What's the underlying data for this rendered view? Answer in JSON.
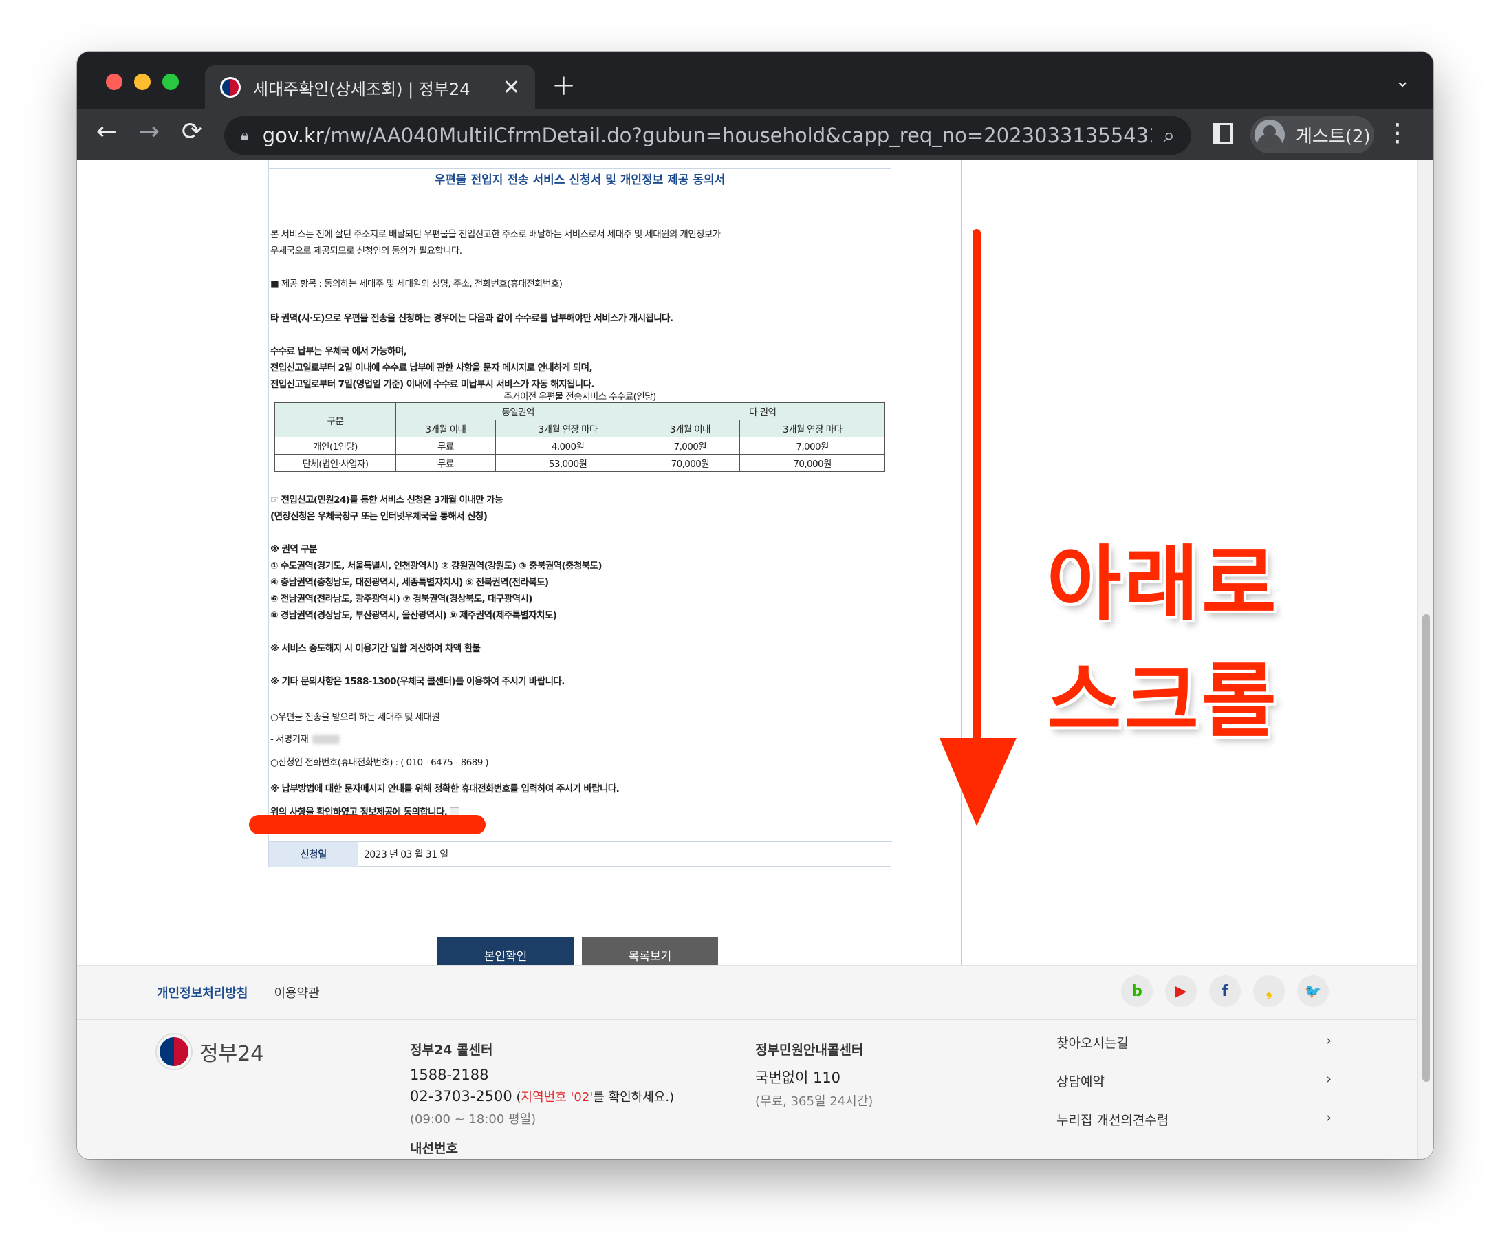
{
  "browser": {
    "tab_title": "세대주확인(상세조회) | 정부24",
    "tab_close": "✕",
    "new_tab": "+",
    "url_host": "gov.kr",
    "url_path": "/mw/AA040MultiICfrmDetail.do?gubun=household&capp_req_no=2023033135543177...",
    "profile_label": "게스트(2)"
  },
  "doc": {
    "title": "우편물 전입지 전송 서비스 신청서 및 개인정보 제공 동의서",
    "intro_1": "본 서비스는 전에 살던 주소지로 배달되던 우편물을 전입신고한 주소로 배달하는 서비스로서 세대주 및 세대원의 개인정보가",
    "intro_2": "우체국으로 제공되므로 신청인의 동의가 필요합니다.",
    "items": "■ 제공 항목 : 동의하는 세대주 및 세대원의 성명, 주소, 전화번호(휴대전화번호)",
    "other_region": "타 권역(시·도)으로 우편물 전송을 신청하는 경우에는 다음과 같이 수수료를 납부해야만 서비스가 개시됩니다.",
    "fee_1": "수수료 납부는 우체국 에서 가능하며,",
    "fee_2": "전입신고일로부터 2일 이내에 수수료 납부에 관한 사항을 문자 메시지로 안내하게 되며,",
    "fee_3": "전입신고일로부터 7일(영업일 기준) 이내에 수수료 미납부시 서비스가 자동 해지됩니다.",
    "table_caption": "주거이전 우편물 전송서비스 수수료(인당)",
    "table": {
      "h_category": "구분",
      "h_same": "동일권역",
      "h_other": "타 권역",
      "h_within3": "3개월 이내",
      "h_ext3": "3개월 연장 마다",
      "rows": [
        {
          "label": "개인(1인당)",
          "v1": "무료",
          "v2": "4,000원",
          "v3": "7,000원",
          "v4": "7,000원"
        },
        {
          "label": "단체(법인·사업자)",
          "v1": "무료",
          "v2": "53,000원",
          "v3": "70,000원",
          "v4": "70,000원"
        }
      ]
    },
    "note_1": "☞ 전입신고(민원24)를 통한 서비스 신청은 3개월 이내만 가능",
    "note_2": "(연장신청은 우체국창구 또는 인터넷우체국을 통해서 신청)",
    "region_h": "※ 권역 구분",
    "region_1": "① 수도권역(경기도, 서울특별시, 인천광역시) ② 강원권역(강원도) ③ 충북권역(충청북도)",
    "region_2": "④ 충남권역(충청남도, 대전광역시, 세종특별자치시) ⑤ 전북권역(전라북도)",
    "region_3": "⑥ 전남권역(전라남도, 광주광역시) ⑦ 경북권역(경상북도, 대구광역시)",
    "region_4": "⑧ 경남권역(경상남도, 부산광역시, 울산광역시) ⑨ 제주권역(제주특별자치도)",
    "refund": "※ 서비스 중도해지 시 이용기간 일할 계산하여 차액 환불",
    "contact": "※ 기타 문의사항은 1588-1300(우체국 콜센터)를 이용하여 주시기 바랍니다.",
    "recipients": "○우편물 전송을 받으려 하는 세대주 및 세대원",
    "signer": " - 서명기재",
    "phone": "○신청인 전화번호(휴대전화번호) : ( 010 - 6475 - 8689 )",
    "phone_note": "※ 납부방법에 대한 문자메시지 안내를 위해 정확한 휴대전화번호를 입력하여 주시기 바랍니다.",
    "consent": "위의 사항을 확인하였고 정보제공에 동의합니다.",
    "date_label": "신청일",
    "date_value": "2023 년 03 월 31 일"
  },
  "buttons": {
    "verify": "본인확인",
    "list": "목록보기"
  },
  "overlay": {
    "line1": "아래로",
    "line2": "스크롤",
    "color": "#ff2a00"
  },
  "footer": {
    "privacy": "개인정보처리방침",
    "terms": "이용약관",
    "social": [
      "b",
      "▶",
      "f",
      "❟",
      "🐦"
    ],
    "logo_text": "정부24",
    "col1_title": "정부24 콜센터",
    "col1_phone": "1588-2188",
    "col1_phone2": "02-3703-2500",
    "col1_note_pre": " (",
    "col1_note_red": "지역번호 '02'",
    "col1_note_post": "를 확인하세요.)",
    "col1_hours": "(09:00 ~ 18:00 평일)",
    "col1_ext": "내선번호",
    "col2_title": "정부민원안내콜센터",
    "col2_phone": "국번없이 110",
    "col2_hours": "(무료, 365일 24시간)",
    "links": [
      "찾아오시는길",
      "상담예약",
      "누리집 개선의견수렴"
    ]
  }
}
